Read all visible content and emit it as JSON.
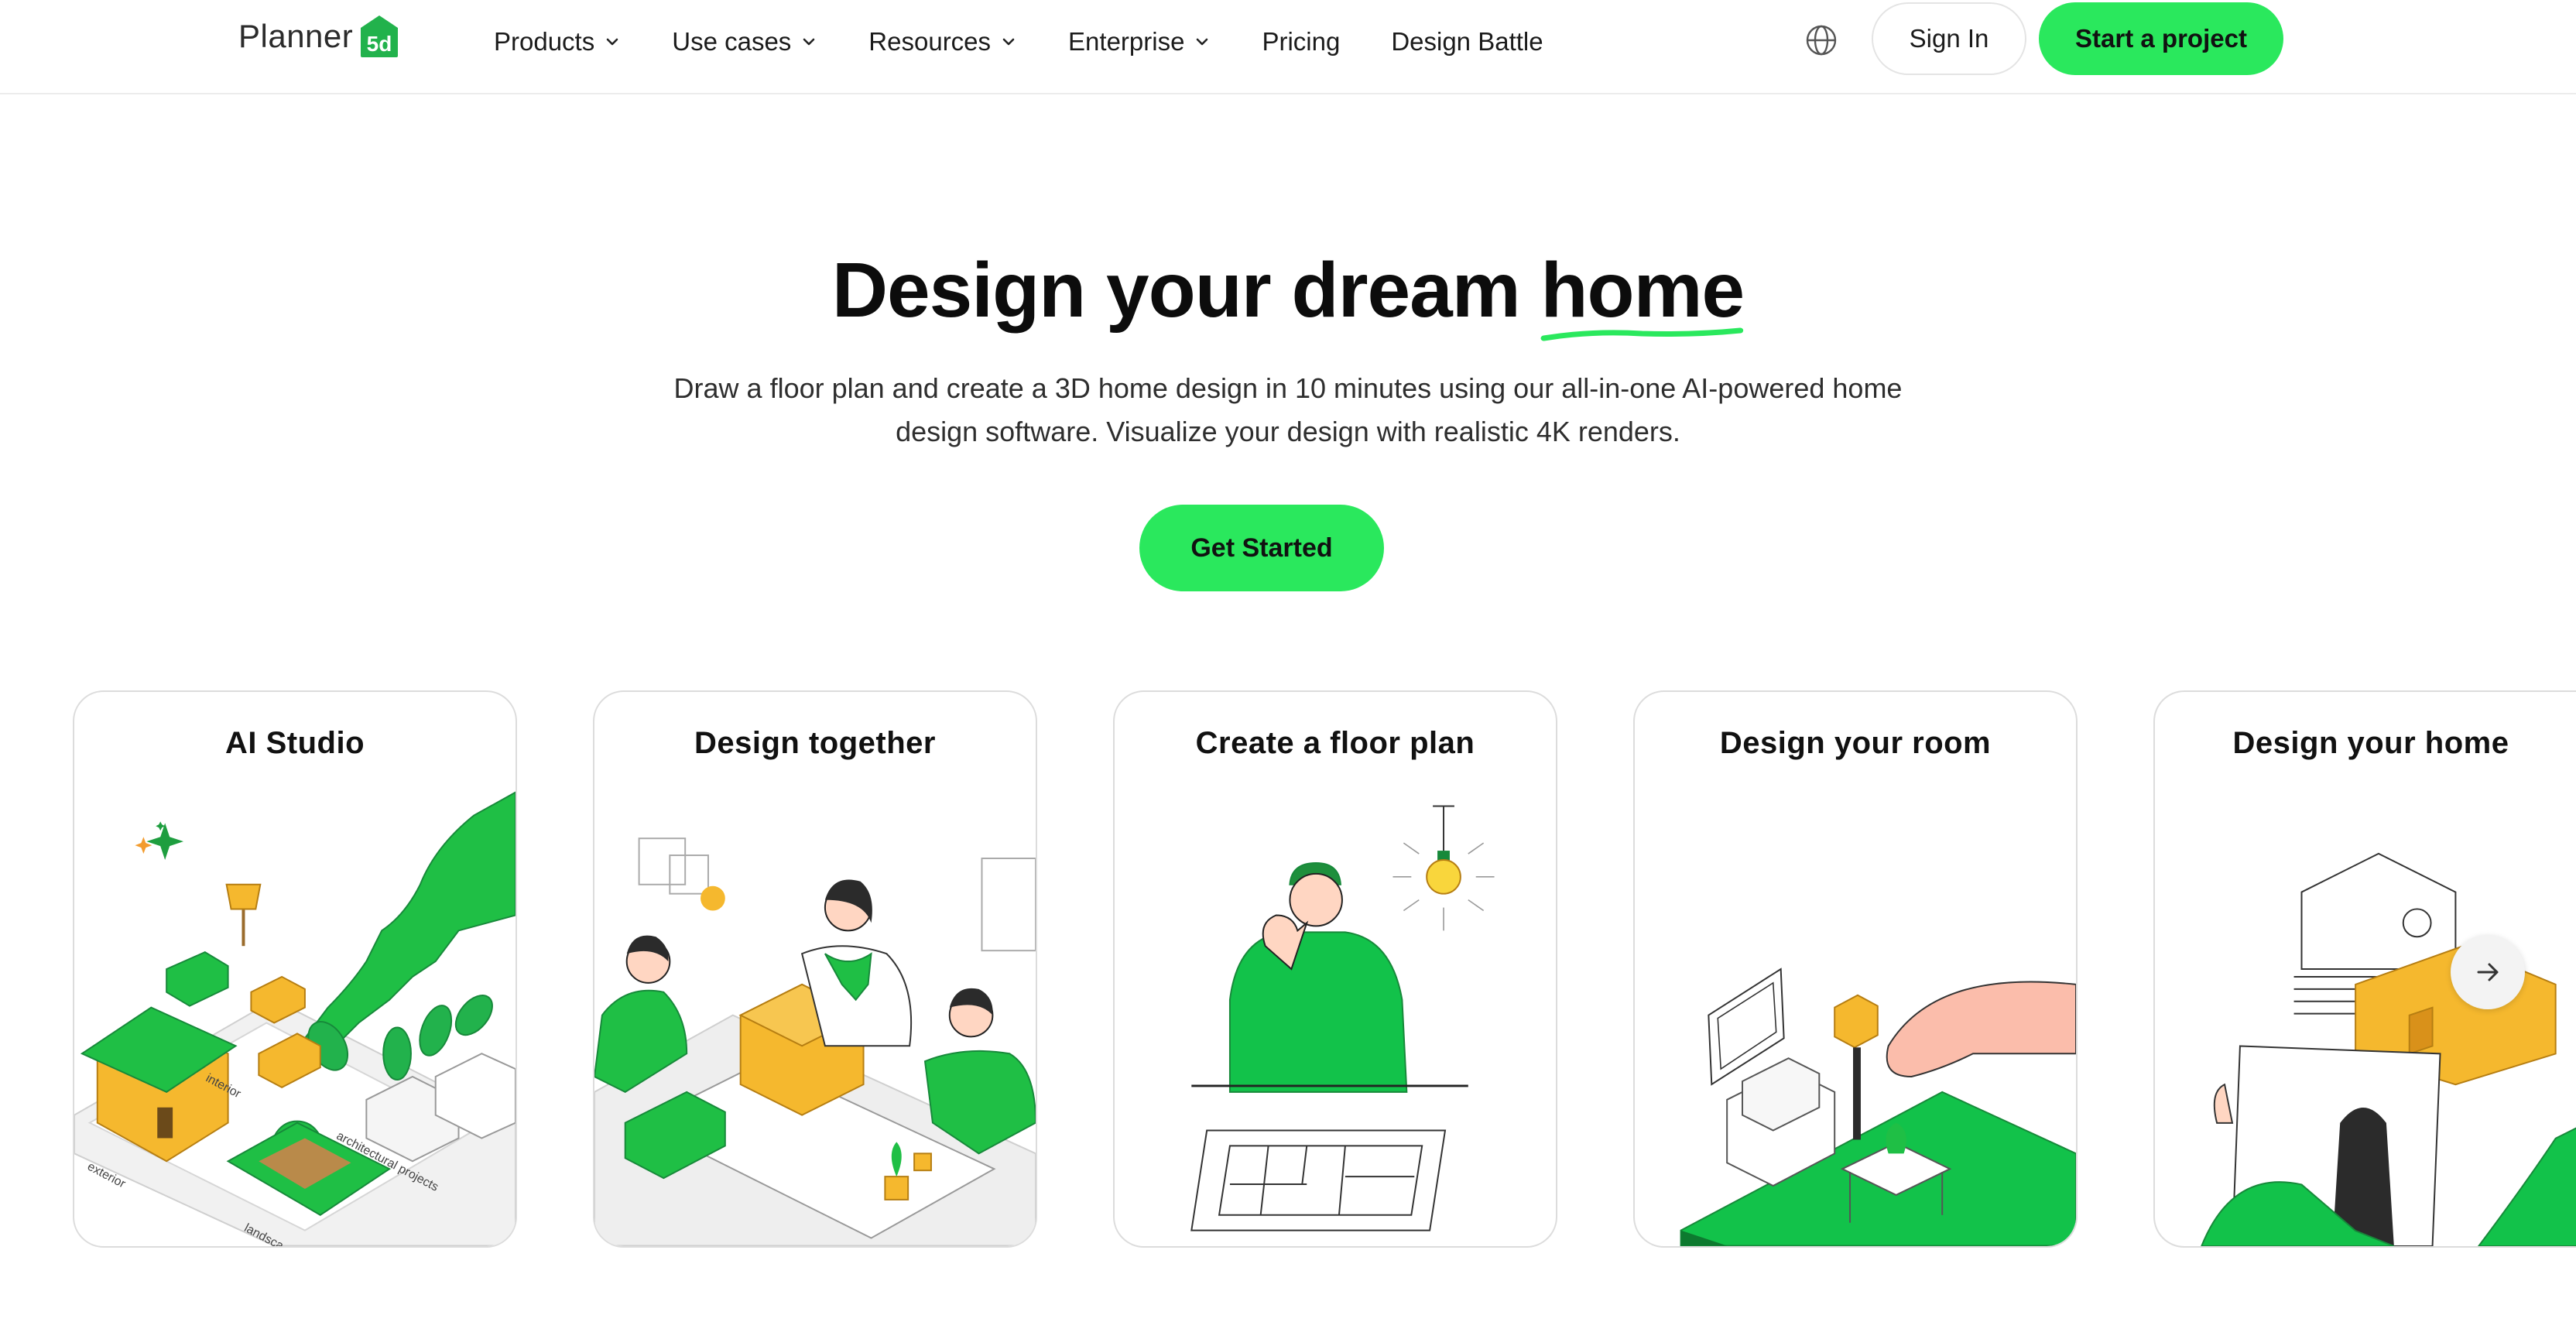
{
  "header": {
    "logo_text": "Planner",
    "logo_mark": "5d",
    "nav": [
      {
        "label": "Products",
        "has_dropdown": true
      },
      {
        "label": "Use cases",
        "has_dropdown": true
      },
      {
        "label": "Resources",
        "has_dropdown": true
      },
      {
        "label": "Enterprise",
        "has_dropdown": true
      },
      {
        "label": "Pricing",
        "has_dropdown": false
      },
      {
        "label": "Design Battle",
        "has_dropdown": false
      }
    ],
    "language_icon": "globe-icon",
    "sign_in_label": "Sign In",
    "start_label": "Start a project"
  },
  "hero": {
    "title_prefix": "Design your dream ",
    "title_highlight": "home",
    "subtitle": "Draw a floor plan and create a 3D home design in 10 minutes using our all-in-one AI-powered home design software. Visualize your design with realistic 4K renders.",
    "cta_label": "Get Started"
  },
  "cards": [
    {
      "title": "AI Studio",
      "art_labels": [
        "interior",
        "exterior",
        "architectural projects",
        "landsca"
      ]
    },
    {
      "title": "Design together"
    },
    {
      "title": "Create a floor plan"
    },
    {
      "title": "Design your room"
    },
    {
      "title": "Design your home"
    }
  ],
  "carousel": {
    "next_icon": "arrow-right-icon"
  },
  "colors": {
    "accent": "#2AE85D",
    "illustration_green": "#1FBF45",
    "illustration_dark_green": "#17893A",
    "illustration_yellow": "#F5B82E",
    "text": "#111111",
    "border": "#DCDCDC"
  }
}
